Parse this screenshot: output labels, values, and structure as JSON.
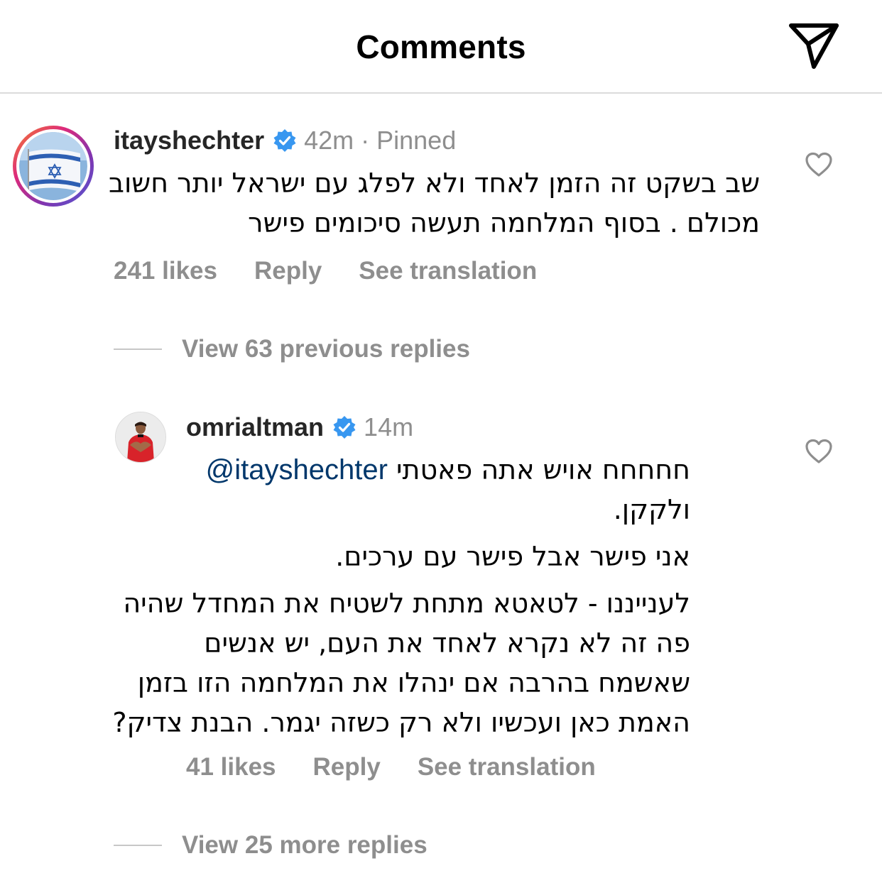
{
  "header": {
    "title": "Comments",
    "share_icon": "paper-plane-icon"
  },
  "comments": [
    {
      "username": "itayshechter",
      "verified": true,
      "time": "42m",
      "pinned_label": "· Pinned",
      "avatar": "israel-flag-avatar",
      "lines": [
        "שב בשקט זה הזמן לאחד ולא לפלג עם ישראל יותר חשוב",
        "מכולם . בסוף המלחמה תעשה סיכומים פישר"
      ],
      "likes": "241 likes",
      "reply": "Reply",
      "see_translation": "See translation"
    }
  ],
  "view_previous": "View 63 previous replies",
  "reply": {
    "username": "omrialtman",
    "verified": true,
    "time": "14m",
    "avatar": "player-avatar",
    "mention": "@itayshechter",
    "line1_text": "חחחחח אויש אתה פאטתי",
    "line2": "ולקקן.",
    "line3": "אני פישר אבל פישר עם ערכים.",
    "line4": "לענייננו - לטאטא מתחת לשטיח את המחדל שהיה",
    "line5": "פה זה לא נקרא לאחד את העם, יש אנשים",
    "line6": "שאשמח בהרבה אם ינהלו את המלחמה הזו בזמן",
    "line7": "האמת כאן ועכשיו ולא רק כשזה יגמר. הבנת צדיק?",
    "likes": "41 likes",
    "reply_label": "Reply",
    "see_translation": "See translation"
  },
  "view_more": "View 25 more replies",
  "colors": {
    "secondary_text": "#8e8e8e",
    "mention": "#00376b",
    "verified": "#3897f0",
    "divider": "#dbdbdb"
  }
}
